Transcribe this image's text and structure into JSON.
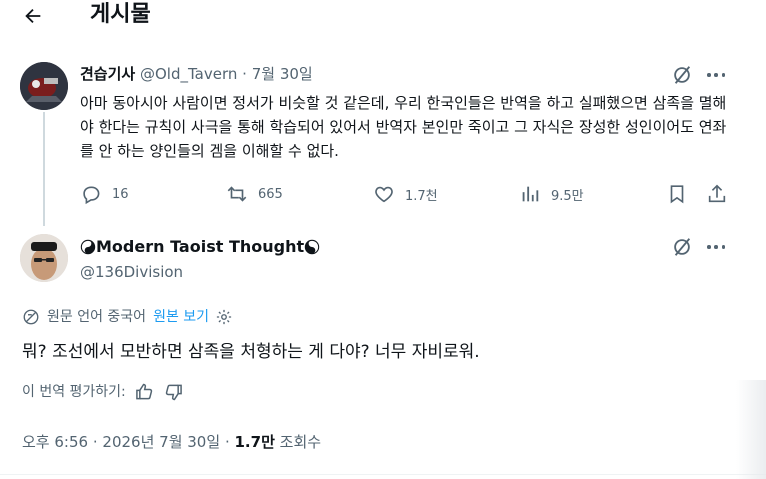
{
  "header": {
    "back_icon": "arrow-left-icon",
    "title": "게시물"
  },
  "parent_post": {
    "display_name": "견습기사",
    "handle": "@Old_Tavern",
    "separator": "·",
    "date": "7월 30일",
    "text": "아마 동아시아 사람이면 정서가 비슷할 것 같은데, 우리 한국인들은 반역을 하고 실패했으면 삼족을 멸해야 한다는 규칙이 사극을 통해 학습되어 있어서 반역자 본인만 죽이고 그 자식은 장성한 성인이어도 연좌를 안 하는 양인들의 겜을 이해할 수 없다.",
    "actions": {
      "replies": "16",
      "reposts": "665",
      "likes": "1.7천",
      "views": "9.5만"
    }
  },
  "main_post": {
    "display_name": "Modern Taoist Thought",
    "name_icon_left": "yin-yang-icon",
    "name_icon_right": "yin-yang-icon",
    "handle": "@136Division",
    "translation": {
      "label": "원문 언어 중국어",
      "show_original": "원본 보기"
    },
    "text": "뭐? 조선에서 모반하면 삼족을 처형하는 게 다야? 너무 자비로워.",
    "rate_label": "이 번역 평가하기:",
    "time": "오후 6:56",
    "separator": "·",
    "date": "2026년 7월 30일",
    "views_count": "1.7만",
    "views_label": "조회수"
  },
  "colors": {
    "text": "#0f1419",
    "muted": "#536471",
    "link": "#1d9bf0",
    "line": "#cfd9de"
  }
}
